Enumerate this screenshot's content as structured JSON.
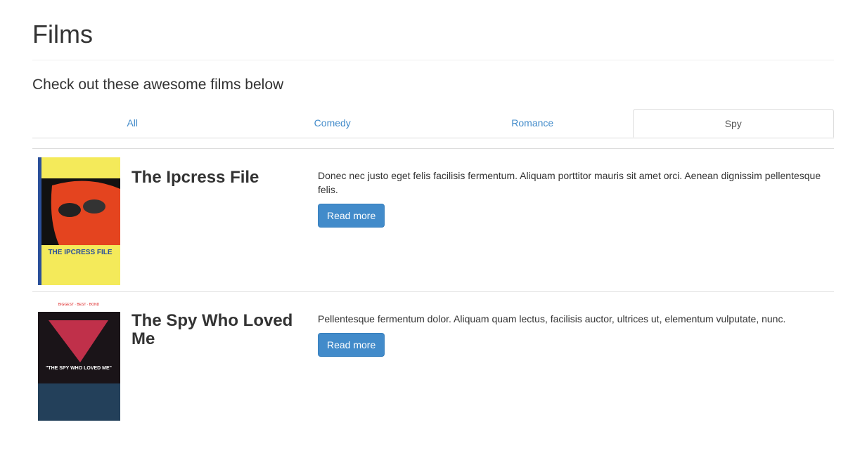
{
  "page": {
    "title": "Films",
    "lead": "Check out these awesome films below"
  },
  "tabs": [
    {
      "label": "All"
    },
    {
      "label": "Comedy"
    },
    {
      "label": "Romance"
    },
    {
      "label": "Spy",
      "active": true
    }
  ],
  "films": [
    {
      "title": "The Ipcress File",
      "description": "Donec nec justo eget felis facilisis fermentum. Aliquam porttitor mauris sit amet orci. Aenean dignissim pellentesque felis.",
      "button": "Read more",
      "poster_text": "THE IPCRESS FILE"
    },
    {
      "title": "The Spy Who Loved Me",
      "description": "Pellentesque fermentum dolor. Aliquam quam lectus, facilisis auctor, ultrices ut, elementum vulputate, nunc.",
      "button": "Read more",
      "poster_text": "\"THE SPY WHO LOVED ME\""
    }
  ]
}
